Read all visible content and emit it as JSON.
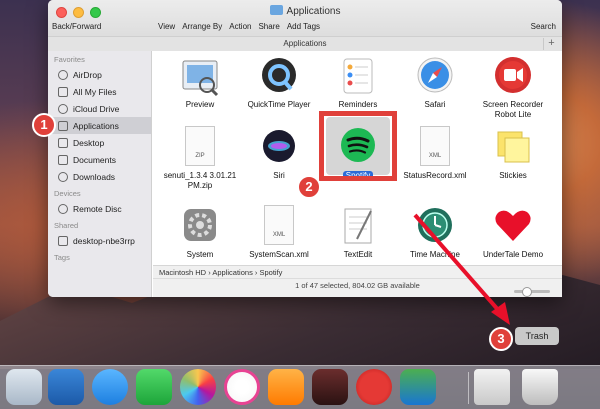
{
  "window": {
    "title": "Applications",
    "back_forward": "Back/Forward",
    "toolbar": [
      "View",
      "Arrange By",
      "Action",
      "Share",
      "Add Tags"
    ],
    "search_label": "Search",
    "path_title": "Applications",
    "plus_label": "+"
  },
  "sidebar": {
    "favorites_header": "Favorites",
    "favorites": [
      "AirDrop",
      "All My Files",
      "iCloud Drive",
      "Applications",
      "Desktop",
      "Documents",
      "Downloads"
    ],
    "devices_header": "Devices",
    "devices": [
      "Remote Disc"
    ],
    "shared_header": "Shared",
    "shared": [
      "desktop-nbe3rrp"
    ],
    "tags_header": "Tags"
  },
  "apps": {
    "row1": [
      "Preview",
      "QuickTime Player",
      "Reminders",
      "Safari",
      "Screen Recorder Robot Lite"
    ],
    "row2": [
      "senuti_1.3.4 3.01.21 PM.zip",
      "Siri",
      "Spotify",
      "StatusRecord.xml",
      "Stickies"
    ],
    "row3": [
      "System",
      "SystemScan.xml",
      "TextEdit",
      "Time Machine",
      "UnderTale Demo"
    ],
    "doc_tags": {
      "zip": "ZIP",
      "xml": "XML"
    }
  },
  "statusbar": {
    "crumbs": [
      "Macintosh HD",
      "Applications",
      "Spotify"
    ],
    "status": "1 of 47 selected, 804.02 GB available"
  },
  "callouts": [
    "1",
    "2",
    "3"
  ],
  "trash_label": "Trash",
  "colors": {
    "accent_red": "#e0403a",
    "selection_blue": "#2a6bd8",
    "spotify_green": "#1db954"
  }
}
